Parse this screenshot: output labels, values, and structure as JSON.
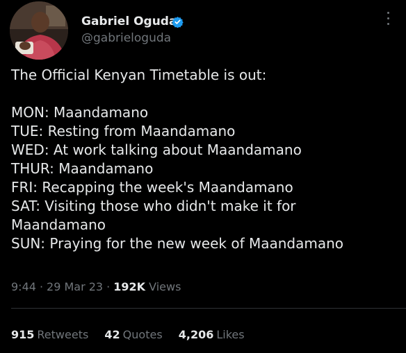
{
  "author": {
    "name": "Gabriel Oguda",
    "handle": "@gabrieloguda",
    "verified_icon": "verified-badge-icon",
    "badge_color": "#1d9bf0"
  },
  "tweet": {
    "lines": [
      "The Official Kenyan Timetable is out:",
      "",
      "MON: Maandamano",
      "TUE: Resting from Maandamano",
      "WED: At work talking about Maandamano",
      "THUR: Maandamano",
      "FRI: Recapping the week's Maandamano",
      "SAT: Visiting those who didn't make it for",
      "Maandamano",
      "SUN: Praying for the new week of Maandamano"
    ]
  },
  "meta": {
    "time": "9:44",
    "separator": "·",
    "date": "29 Mar 23",
    "views_count": "192K",
    "views_label": "Views"
  },
  "stats": {
    "retweets_count": "915",
    "retweets_label": "Retweets",
    "quotes_count": "42",
    "quotes_label": "Quotes",
    "likes_count": "4,206",
    "likes_label": "Likes"
  },
  "colors": {
    "background": "#000000",
    "text_primary": "#e7e9ea",
    "text_secondary": "#71767b",
    "divider": "#2f3336"
  }
}
